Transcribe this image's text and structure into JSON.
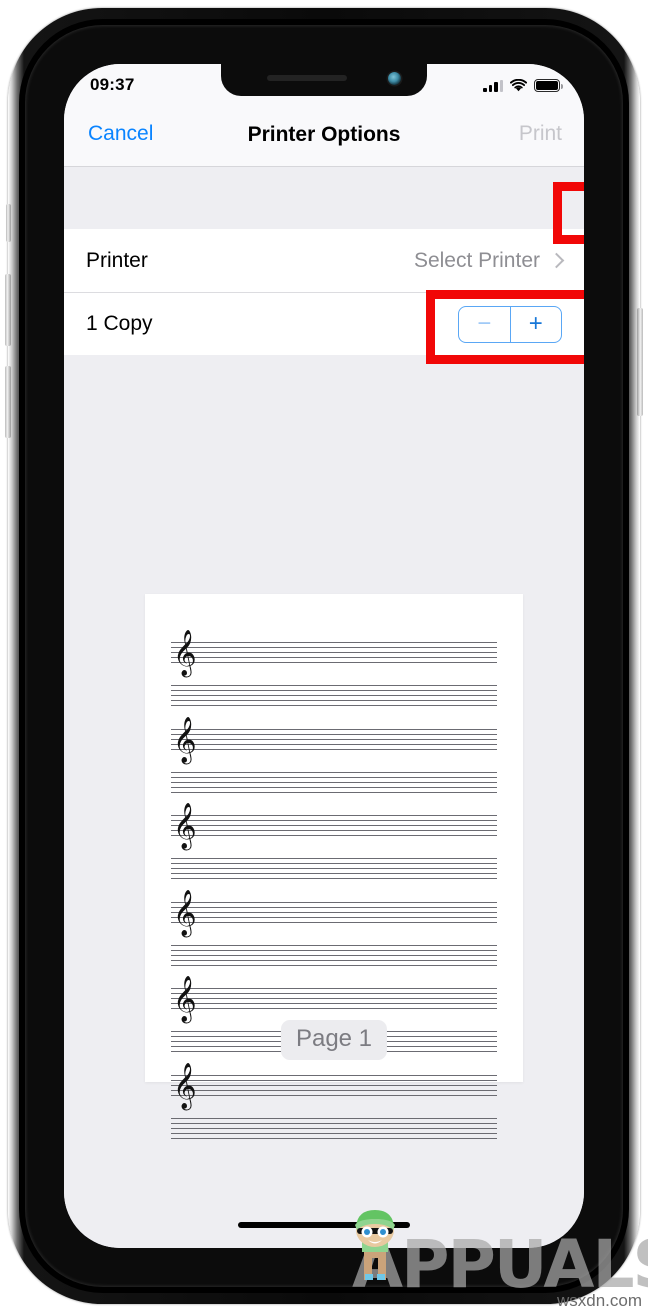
{
  "status_bar": {
    "time": "09:37",
    "signal_icon": "cellular-signal-icon",
    "signal_bars_filled": 3,
    "signal_bars_total": 4,
    "wifi_icon": "wifi-icon",
    "battery_icon": "battery-full-icon",
    "battery_level_percent": 100
  },
  "nav_bar": {
    "cancel_label": "Cancel",
    "title": "Printer Options",
    "print_label": "Print",
    "print_enabled": false,
    "cancel_color": "#0a84ff",
    "print_disabled_color": "#c6c6cb"
  },
  "settings": {
    "printer_row": {
      "label": "Printer",
      "value": "Select Printer",
      "chevron_icon": "chevron-right-icon"
    },
    "copies_row": {
      "label": "1 Copy",
      "minus_label": "−",
      "plus_label": "+",
      "minus_enabled": false,
      "plus_enabled": true
    }
  },
  "preview": {
    "page_label": "Page 1",
    "staff_groups": 6,
    "lines_per_staff": 5,
    "clef_glyph": "𝄞",
    "clef_name": "treble-clef-icon"
  },
  "highlights": [
    {
      "name": "print-button-highlight",
      "color": "#f10707"
    },
    {
      "name": "select-printer-highlight",
      "color": "#f10707"
    }
  ],
  "watermark": {
    "brand": "APPUALS",
    "site": "wsxdn.com"
  },
  "colors": {
    "accent_blue": "#0a84ff",
    "screen_bg": "#eeeef2",
    "card_bg": "#ffffff",
    "nav_bg": "#f9f9fb",
    "secondary_text": "#8e8e93",
    "highlight_red": "#f10707"
  }
}
